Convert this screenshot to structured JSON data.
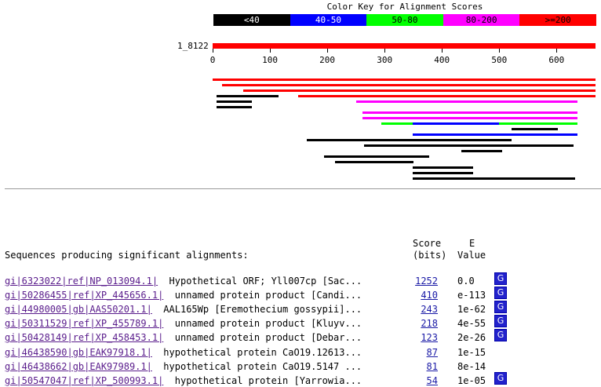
{
  "color_key": {
    "title": "Color Key for Alignment Scores",
    "segments": [
      {
        "label": "<40",
        "color": "#000000",
        "text_color": "#ffffff"
      },
      {
        "label": "40-50",
        "color": "#0000ff",
        "text_color": "#ffffff"
      },
      {
        "label": "50-80",
        "color": "#00ff00",
        "text_color": "#000000"
      },
      {
        "label": "80-200",
        "color": "#ff00ff",
        "text_color": "#000000"
      },
      {
        "label": ">=200",
        "color": "#ff0000",
        "text_color": "#000000"
      }
    ]
  },
  "query": {
    "label": "1_8122",
    "length": 668,
    "ticks": [
      "0",
      "100",
      "200",
      "300",
      "400",
      "500",
      "600"
    ]
  },
  "hit_colors": {
    "red": "#ff0000",
    "magenta": "#ff00ff",
    "green": "#00ff00",
    "blue": "#0000ff",
    "black": "#000000"
  },
  "hits": [
    {
      "start": 1,
      "end": 668,
      "color": "red"
    },
    {
      "start": 18,
      "end": 668,
      "color": "red"
    },
    {
      "start": 55,
      "end": 668,
      "color": "red"
    },
    {
      "start": 8,
      "end": 115,
      "color": "black"
    },
    {
      "start": 150,
      "end": 668,
      "color": "red"
    },
    {
      "start": 8,
      "end": 68,
      "color": "black"
    },
    {
      "start": 252,
      "end": 637,
      "color": "magenta"
    },
    {
      "start": 8,
      "end": 68,
      "color": "black"
    },
    {
      "start": 262,
      "end": 637,
      "color": "magenta"
    },
    {
      "start": 262,
      "end": 637,
      "color": "magenta"
    },
    {
      "start": 295,
      "end": 637,
      "color": "green"
    },
    {
      "start": 350,
      "end": 500,
      "color": "blue"
    },
    {
      "start": 522,
      "end": 602,
      "color": "black"
    },
    {
      "start": 350,
      "end": 637,
      "color": "blue"
    },
    {
      "start": 165,
      "end": 522,
      "color": "black"
    },
    {
      "start": 340,
      "end": 630,
      "color": "black"
    },
    {
      "start": 265,
      "end": 418,
      "color": "black"
    },
    {
      "start": 435,
      "end": 505,
      "color": "black"
    },
    {
      "start": 195,
      "end": 378,
      "color": "black"
    },
    {
      "start": 215,
      "end": 350,
      "color": "black"
    },
    {
      "start": 350,
      "end": 455,
      "color": "black"
    },
    {
      "start": 350,
      "end": 455,
      "color": "black"
    },
    {
      "start": 350,
      "end": 455,
      "color": "black"
    },
    {
      "start": 350,
      "end": 632,
      "color": "black"
    }
  ],
  "results": {
    "header_label": "Sequences producing significant alignments:",
    "score_header_1": "Score",
    "score_header_2": "(bits)",
    "e_header_1": "E",
    "e_header_2": "Value",
    "gene_link_label": "G",
    "rows": [
      {
        "id": "gi|6323022|ref|NP_013094.1|",
        "desc": "  Hypothetical ORF; Yll007cp [Sac...",
        "score": "1252",
        "evalue": "0.0",
        "g": true
      },
      {
        "id": "gi|50286455|ref|XP_445656.1|",
        "desc": "  unnamed protein product [Candi...",
        "score": "410",
        "evalue": "e-113",
        "g": true
      },
      {
        "id": "gi|44980005|gb|AAS50201.1|",
        "desc": "  AAL165Wp [Eremothecium gossypii]...",
        "score": "243",
        "evalue": "1e-62",
        "g": true
      },
      {
        "id": "gi|50311529|ref|XP_455789.1|",
        "desc": "  unnamed protein product [Kluyv...",
        "score": "218",
        "evalue": "4e-55",
        "g": true
      },
      {
        "id": "gi|50428149|ref|XP_458453.1|",
        "desc": "  unnamed protein product [Debar...",
        "score": "123",
        "evalue": "2e-26",
        "g": true
      },
      {
        "id": "gi|46438590|gb|EAK97918.1|",
        "desc": "  hypothetical protein CaO19.12613...",
        "score": "87",
        "evalue": "1e-15",
        "g": false
      },
      {
        "id": "gi|46438662|gb|EAK97989.1|",
        "desc": "  hypothetical protein CaO19.5147 ...",
        "score": "81",
        "evalue": "8e-14",
        "g": false
      },
      {
        "id": "gi|50547047|ref|XP_500993.1|",
        "desc": "  hypothetical protein [Yarrowia...",
        "score": "54",
        "evalue": "1e-05",
        "g": true
      }
    ]
  }
}
